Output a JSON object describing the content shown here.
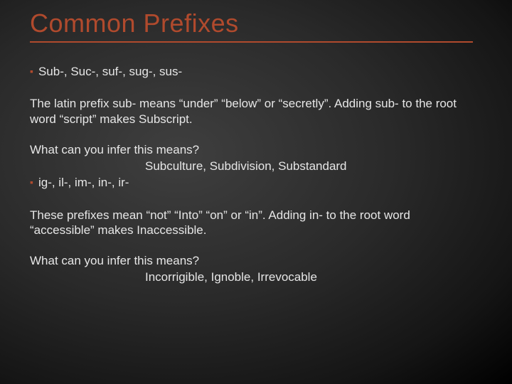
{
  "title": "Common Prefixes",
  "bullet1": "Sub-, Suc-, suf-, sug-, sus-",
  "para1": "The latin prefix sub- means “under” “below” or “secretly”. Adding sub- to the root word “script” makes Subscript.",
  "infer1_q": "What can you infer this means?",
  "infer1_ex": "Subculture, Subdivision, Substandard",
  "bullet2": "ig-, il-, im-, in-, ir-",
  "para2": "These prefixes mean “not” “Into” “on” or “in”. Adding in- to the root word “accessible” makes Inaccessible.",
  "infer2_q": "What can you infer this means?",
  "infer2_ex": "Incorrigible, Ignoble, Irrevocable"
}
